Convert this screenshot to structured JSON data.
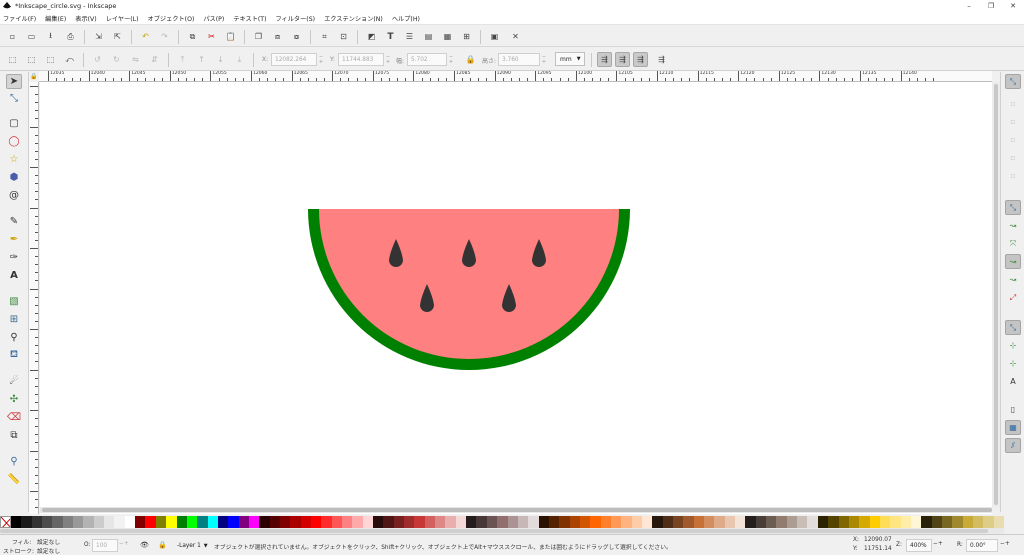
{
  "window": {
    "title": "*Inkscape_circle.svg - Inkscape",
    "minimize": "–",
    "maximize": "❐",
    "close": "✕"
  },
  "menu": [
    "ファイル(F)",
    "編集(E)",
    "表示(V)",
    "レイヤー(L)",
    "オブジェクト(O)",
    "パス(P)",
    "テキスト(T)",
    "フィルター(S)",
    "エクステンション(N)",
    "ヘルプ(H)"
  ],
  "controls": {
    "x_label": "X:",
    "x_value": "12082.264",
    "y_label": "Y:",
    "y_value": "11744.883",
    "w_label": "幅:",
    "w_value": "5.702",
    "h_label": "高さ:",
    "h_value": "3.760",
    "unit": "mm"
  },
  "ruler": {
    "labels": [
      "12035",
      "12040",
      "12045",
      "12050",
      "12055",
      "12060",
      "12065",
      "12070",
      "12075",
      "12080",
      "12085",
      "12090",
      "12095",
      "12100",
      "12105",
      "12110",
      "12115",
      "12120",
      "12125",
      "12130",
      "12135",
      "12140"
    ]
  },
  "colors": {
    "flesh": "#ff8080",
    "rind": "#008000",
    "seed": "#333333"
  },
  "palette": [
    "#000000",
    "#1a1a1a",
    "#333333",
    "#4d4d4d",
    "#666666",
    "#808080",
    "#999999",
    "#b3b3b3",
    "#cccccc",
    "#e6e6e6",
    "#f2f2f2",
    "#ffffff",
    "#800000",
    "#ff0000",
    "#808000",
    "#ffff00",
    "#008000",
    "#00ff00",
    "#008080",
    "#00ffff",
    "#000080",
    "#0000ff",
    "#800080",
    "#ff00ff",
    "#2b0000",
    "#550000",
    "#800000",
    "#aa0000",
    "#d40000",
    "#ff0000",
    "#ff2a2a",
    "#ff5555",
    "#ff8080",
    "#ffaaaa",
    "#ffd5d5",
    "#280b0b",
    "#501616",
    "#782121",
    "#a02c2c",
    "#c83737",
    "#d35f5f",
    "#de8787",
    "#e9afaf",
    "#f4d7d7",
    "#241c1c",
    "#483737",
    "#6c5353",
    "#916f6f",
    "#ac9393",
    "#c8b7b7",
    "#e3dbdb",
    "#2b1100",
    "#552200",
    "#803300",
    "#aa4400",
    "#d45500",
    "#ff6600",
    "#ff7f2a",
    "#ff9955",
    "#ffb380",
    "#ffccaa",
    "#ffe6d5",
    "#28170b",
    "#502d16",
    "#784421",
    "#a05a2c",
    "#c87137",
    "#d38d5f",
    "#deaa87",
    "#e9c6af",
    "#f4e3d7",
    "#241f1c",
    "#483e37",
    "#6c5d53",
    "#917c6f",
    "#ac9d93",
    "#c8beb7",
    "#e3dedb",
    "#2b2200",
    "#554400",
    "#806600",
    "#aa8800",
    "#d4aa00",
    "#ffcc00",
    "#ffdd55",
    "#ffe680",
    "#ffeeaa",
    "#fff6d5",
    "#28220b",
    "#504416",
    "#786721",
    "#a0892c",
    "#c8ab37",
    "#d3bc5f",
    "#decd87",
    "#e9ddaf"
  ],
  "status": {
    "fill_label": "フィル:",
    "fill_value": "設定なし",
    "stroke_label": "ストローク:",
    "stroke_value": "設定なし",
    "opacity_label": "O:",
    "opacity_value": "100",
    "layer": "-Layer 1",
    "message": "オブジェクトが選択されていません。オブジェクトをクリック、Shift+クリック、オブジェクト上でAlt+マウススクロール、または囲むようにドラッグして選択してください。",
    "x_label": "X:",
    "x_value": "12090.07",
    "y_label": "Y:",
    "y_value": "11751.14",
    "zoom_label": "Z:",
    "zoom_value": "400%",
    "rot_label": "R:",
    "rot_value": "0.00°"
  }
}
